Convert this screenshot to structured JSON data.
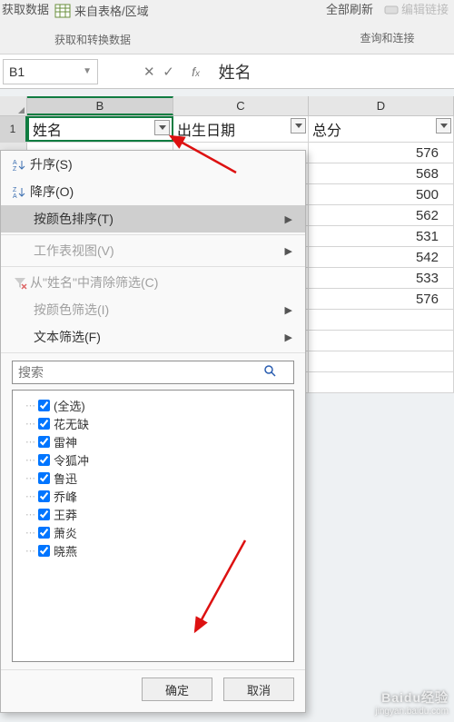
{
  "ribbon": {
    "left_btn1": "获取数据",
    "left_btn2": "来自表格/区域",
    "left_group": "获取和转换数据",
    "right_btn1": "全部刷新",
    "right_btn2": "编辑链接",
    "right_group": "查询和连接"
  },
  "formula": {
    "name_box": "B1",
    "value": "姓名"
  },
  "columns": {
    "B": "B",
    "C": "C",
    "D": "D"
  },
  "headers": {
    "B": "姓名",
    "C": "出生日期",
    "D": "总分"
  },
  "row1": "1",
  "totals": [
    576,
    568,
    500,
    562,
    531,
    542,
    533,
    576
  ],
  "menu": {
    "asc": "升序(S)",
    "desc": "降序(O)",
    "sort_color": "按颜色排序(T)",
    "sheet_view": "工作表视图(V)",
    "clear_filter": "从\"姓名\"中清除筛选(C)",
    "filter_color": "按颜色筛选(I)",
    "text_filter": "文本筛选(F)",
    "search_placeholder": "搜索",
    "items": [
      "(全选)",
      "花无缺",
      "雷神",
      "令狐冲",
      "鲁迅",
      "乔峰",
      "王莽",
      "萧炎",
      "晓燕"
    ],
    "ok": "确定",
    "cancel": "取消"
  },
  "watermark": {
    "line1": "Baidu经验",
    "line2": "jingyan.baidu.com"
  }
}
